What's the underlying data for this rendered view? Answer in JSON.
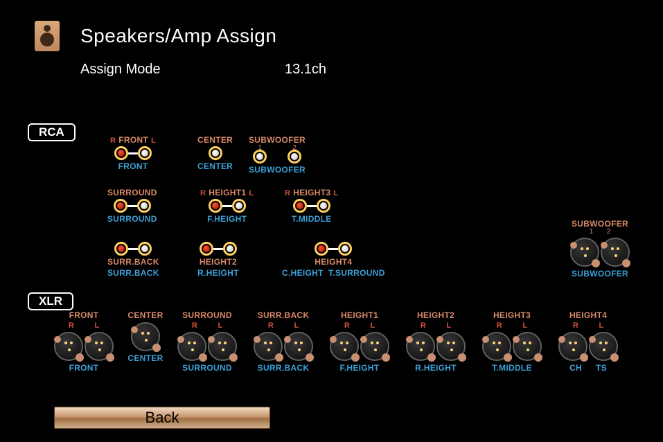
{
  "header": {
    "title": "Speakers/Amp Assign",
    "mode_label": "Assign Mode",
    "mode_value": "13.1ch"
  },
  "section_labels": {
    "rca": "RCA",
    "xlr": "XLR"
  },
  "rca": {
    "front": {
      "top": "FRONT",
      "bot": "FRONT"
    },
    "center": {
      "top": "CENTER",
      "bot": "CENTER"
    },
    "subwoofer": {
      "top": "SUBWOOFER",
      "bot": "SUBWOOFER",
      "n1": "1",
      "n2": "2"
    },
    "surround": {
      "top": "SURROUND",
      "bot": "SURROUND"
    },
    "height1": {
      "top": "HEIGHT1",
      "bot": "F.HEIGHT"
    },
    "height3": {
      "top": "HEIGHT3",
      "bot": "T.MIDDLE"
    },
    "surrback": {
      "top": "SURR.BACK",
      "bot": "SURR.BACK"
    },
    "height2": {
      "top": "HEIGHT2",
      "bot": "R.HEIGHT"
    },
    "height4": {
      "top": "HEIGHT4",
      "botL": "C.HEIGHT",
      "botR": "T.SURROUND"
    }
  },
  "rl": {
    "r": "R",
    "l": "L"
  },
  "xlr_sub": {
    "top": "SUBWOOFER",
    "n1": "1",
    "n2": "2",
    "bot": "SUBWOOFER"
  },
  "xlr": [
    {
      "top": "FRONT",
      "bot": "FRONT"
    },
    {
      "top": "CENTER",
      "bot": "CENTER",
      "single": true
    },
    {
      "top": "SURROUND",
      "bot": "SURROUND"
    },
    {
      "top": "SURR.BACK",
      "bot": "SURR.BACK"
    },
    {
      "top": "HEIGHT1",
      "bot": "F.HEIGHT"
    },
    {
      "top": "HEIGHT2",
      "bot": "R.HEIGHT"
    },
    {
      "top": "HEIGHT3",
      "bot": "T.MIDDLE"
    },
    {
      "top": "HEIGHT4",
      "botL": "CH",
      "botR": "TS"
    }
  ],
  "back_label": "Back"
}
